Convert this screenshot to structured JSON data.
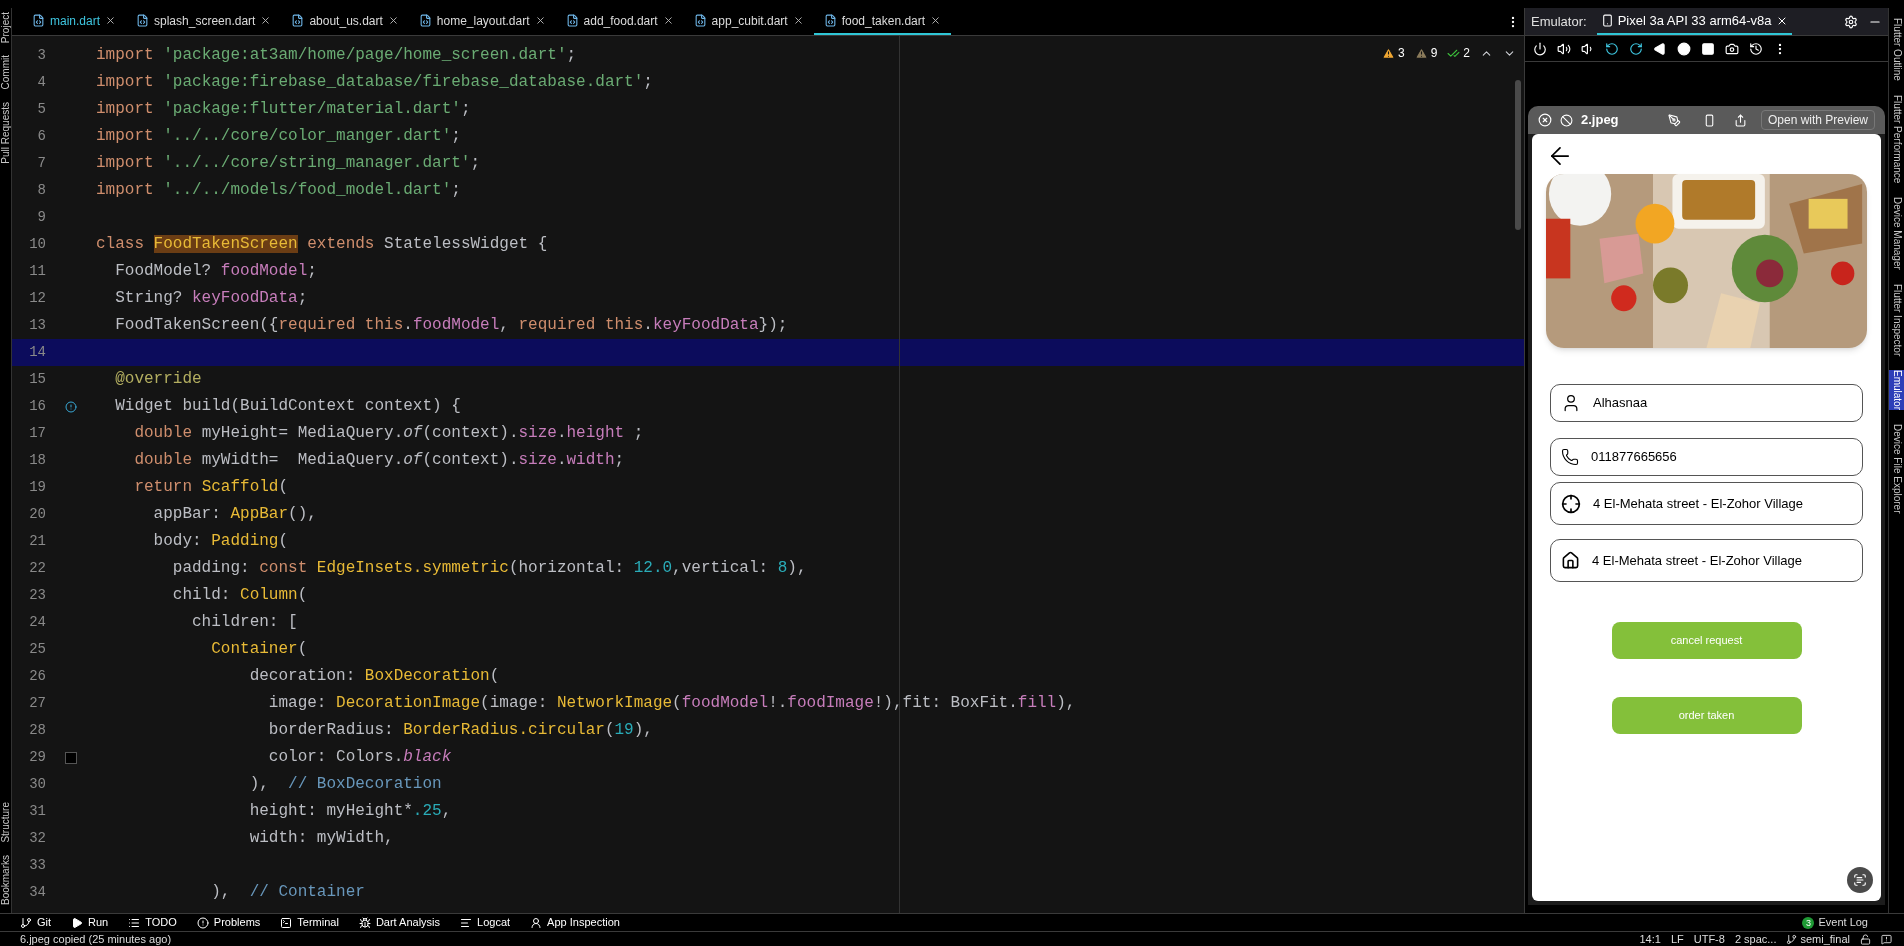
{
  "left_tool_windows_top": [
    {
      "label": "Project"
    },
    {
      "label": "Commit"
    },
    {
      "label": "Pull Requests"
    }
  ],
  "left_tool_windows_bottom": [
    {
      "label": "Structure"
    },
    {
      "label": "Bookmarks"
    }
  ],
  "editor_tabs": [
    {
      "label": "main.dart",
      "selected": false,
      "vcs_changed": true
    },
    {
      "label": "splash_screen.dart",
      "selected": false,
      "vcs_changed": false
    },
    {
      "label": "about_us.dart",
      "selected": false,
      "vcs_changed": false
    },
    {
      "label": "home_layout.dart",
      "selected": false,
      "vcs_changed": false
    },
    {
      "label": "add_food.dart",
      "selected": false,
      "vcs_changed": false
    },
    {
      "label": "app_cubit.dart",
      "selected": false,
      "vcs_changed": false
    },
    {
      "label": "food_taken.dart",
      "selected": true,
      "vcs_changed": false
    }
  ],
  "inspections": [
    {
      "kind": "warning",
      "count": "3"
    },
    {
      "kind": "weak_warning",
      "count": "9"
    },
    {
      "kind": "typo",
      "count": "2"
    }
  ],
  "code_lines": [
    {
      "number": "3",
      "current": false,
      "tokens": [
        {
          "kind": "kw",
          "text": "import "
        },
        {
          "kind": "str",
          "text": "'package:at3am/home/page/home_screen.dart'"
        },
        {
          "kind": "p",
          "text": ";"
        }
      ]
    },
    {
      "number": "4",
      "current": false,
      "tokens": [
        {
          "kind": "kw",
          "text": "import "
        },
        {
          "kind": "str",
          "text": "'package:firebase_database/firebase_database.dart'"
        },
        {
          "kind": "p",
          "text": ";"
        }
      ]
    },
    {
      "number": "5",
      "current": false,
      "tokens": [
        {
          "kind": "kw",
          "text": "import "
        },
        {
          "kind": "str",
          "text": "'package:flutter/material.dart'"
        },
        {
          "kind": "p",
          "text": ";"
        }
      ]
    },
    {
      "number": "6",
      "current": false,
      "tokens": [
        {
          "kind": "kw",
          "text": "import "
        },
        {
          "kind": "str",
          "text": "'../../core/color_manger.dart'"
        },
        {
          "kind": "p",
          "text": ";"
        }
      ]
    },
    {
      "number": "7",
      "current": false,
      "tokens": [
        {
          "kind": "kw",
          "text": "import "
        },
        {
          "kind": "str",
          "text": "'../../core/string_manager.dart'"
        },
        {
          "kind": "p",
          "text": ";"
        }
      ]
    },
    {
      "number": "8",
      "current": false,
      "tokens": [
        {
          "kind": "kw",
          "text": "import "
        },
        {
          "kind": "str",
          "text": "'../../models/food_model.dart'"
        },
        {
          "kind": "p",
          "text": ";"
        }
      ]
    },
    {
      "number": "9",
      "current": false
    },
    {
      "number": "10",
      "current": false,
      "tokens": [
        {
          "kind": "kw",
          "text": "class "
        },
        {
          "kind": "hl",
          "text": "FoodTakenScreen"
        },
        {
          "kind": "kw",
          "text": " extends "
        },
        {
          "kind": "p",
          "text": "StatelessWidget {"
        }
      ]
    },
    {
      "number": "11",
      "current": false,
      "tokens": [
        {
          "kind": "p",
          "text": "  FoodModel? "
        },
        {
          "kind": "field",
          "text": "foodModel"
        },
        {
          "kind": "p",
          "text": ";"
        }
      ]
    },
    {
      "number": "12",
      "current": false,
      "tokens": [
        {
          "kind": "p",
          "text": "  String? "
        },
        {
          "kind": "field",
          "text": "keyFoodData"
        },
        {
          "kind": "p",
          "text": ";"
        }
      ]
    },
    {
      "number": "13",
      "current": false,
      "tokens": [
        {
          "kind": "p",
          "text": "  FoodTakenScreen({"
        },
        {
          "kind": "kw",
          "text": "required this"
        },
        {
          "kind": "p",
          "text": "."
        },
        {
          "kind": "field",
          "text": "foodModel"
        },
        {
          "kind": "p",
          "text": ", "
        },
        {
          "kind": "kw",
          "text": "required this"
        },
        {
          "kind": "p",
          "text": "."
        },
        {
          "kind": "field",
          "text": "keyFoodData"
        },
        {
          "kind": "p",
          "text": "});"
        }
      ]
    },
    {
      "number": "14",
      "current": true
    },
    {
      "number": "15",
      "current": false,
      "tokens": [
        {
          "kind": "ann",
          "text": "  @override"
        }
      ]
    },
    {
      "number": "16",
      "current": false,
      "gutter": {
        "kind": "override"
      },
      "tokens": [
        {
          "kind": "p",
          "text": "  Widget build(BuildContext context) {"
        }
      ]
    },
    {
      "number": "17",
      "current": false,
      "tokens": [
        {
          "kind": "kw",
          "text": "    double "
        },
        {
          "kind": "p",
          "text": "myHeight= MediaQuery."
        },
        {
          "kind": "it",
          "text": "of"
        },
        {
          "kind": "p",
          "text": "(context)."
        },
        {
          "kind": "field",
          "text": "size"
        },
        {
          "kind": "p",
          "text": "."
        },
        {
          "kind": "field",
          "text": "height"
        },
        {
          "kind": "p",
          "text": " ;"
        }
      ]
    },
    {
      "number": "18",
      "current": false,
      "tokens": [
        {
          "kind": "kw",
          "text": "    double "
        },
        {
          "kind": "p",
          "text": "myWidth=  MediaQuery."
        },
        {
          "kind": "it",
          "text": "of"
        },
        {
          "kind": "p",
          "text": "(context)."
        },
        {
          "kind": "field",
          "text": "size"
        },
        {
          "kind": "p",
          "text": "."
        },
        {
          "kind": "field",
          "text": "width"
        },
        {
          "kind": "p",
          "text": ";"
        }
      ]
    },
    {
      "number": "19",
      "current": false,
      "tokens": [
        {
          "kind": "kw",
          "text": "    return "
        },
        {
          "kind": "fn",
          "text": "Scaffold"
        },
        {
          "kind": "p",
          "text": "("
        }
      ]
    },
    {
      "number": "20",
      "current": false,
      "tokens": [
        {
          "kind": "p",
          "text": "      appBar: "
        },
        {
          "kind": "fn",
          "text": "AppBar"
        },
        {
          "kind": "p",
          "text": "(),"
        }
      ]
    },
    {
      "number": "21",
      "current": false,
      "tokens": [
        {
          "kind": "p",
          "text": "      body: "
        },
        {
          "kind": "fn",
          "text": "Padding"
        },
        {
          "kind": "p",
          "text": "("
        }
      ]
    },
    {
      "number": "22",
      "current": false,
      "tokens": [
        {
          "kind": "p",
          "text": "        padding: "
        },
        {
          "kind": "kw",
          "text": "const "
        },
        {
          "kind": "fn",
          "text": "EdgeInsets.symmetric"
        },
        {
          "kind": "p",
          "text": "(horizontal: "
        },
        {
          "kind": "num",
          "text": "12.0"
        },
        {
          "kind": "p",
          "text": ",vertical: "
        },
        {
          "kind": "num",
          "text": "8"
        },
        {
          "kind": "p",
          "text": "),"
        }
      ]
    },
    {
      "number": "23",
      "current": false,
      "tokens": [
        {
          "kind": "p",
          "text": "        child: "
        },
        {
          "kind": "fn",
          "text": "Column"
        },
        {
          "kind": "p",
          "text": "("
        }
      ]
    },
    {
      "number": "24",
      "current": false,
      "tokens": [
        {
          "kind": "p",
          "text": "          children: ["
        }
      ]
    },
    {
      "number": "25",
      "current": false,
      "tokens": [
        {
          "kind": "fn",
          "text": "            Container"
        },
        {
          "kind": "p",
          "text": "("
        }
      ]
    },
    {
      "number": "26",
      "current": false,
      "tokens": [
        {
          "kind": "p",
          "text": "                decoration: "
        },
        {
          "kind": "fn",
          "text": "BoxDecoration"
        },
        {
          "kind": "p",
          "text": "("
        }
      ]
    },
    {
      "number": "27",
      "current": false,
      "tokens": [
        {
          "kind": "p",
          "text": "                  image: "
        },
        {
          "kind": "fn",
          "text": "DecorationImage"
        },
        {
          "kind": "p",
          "text": "(image: "
        },
        {
          "kind": "fn",
          "text": "NetworkImage"
        },
        {
          "kind": "p",
          "text": "("
        },
        {
          "kind": "field",
          "text": "foodModel"
        },
        {
          "kind": "p",
          "text": "!."
        },
        {
          "kind": "field",
          "text": "foodImage"
        },
        {
          "kind": "p",
          "text": "!),fit: BoxFit."
        },
        {
          "kind": "field",
          "text": "fill"
        },
        {
          "kind": "p",
          "text": "),"
        }
      ]
    },
    {
      "number": "28",
      "current": false,
      "tokens": [
        {
          "kind": "p",
          "text": "                  borderRadius: "
        },
        {
          "kind": "fn",
          "text": "BorderRadius.circular"
        },
        {
          "kind": "p",
          "text": "("
        },
        {
          "kind": "num",
          "text": "19"
        },
        {
          "kind": "p",
          "text": "),"
        }
      ]
    },
    {
      "number": "29",
      "current": false,
      "gutter": {
        "kind": "swatch"
      },
      "tokens": [
        {
          "kind": "p",
          "text": "                  color: Colors."
        },
        {
          "kind": "fieldit",
          "text": "black"
        }
      ]
    },
    {
      "number": "30",
      "current": false,
      "tokens": [
        {
          "kind": "p",
          "text": "                ),  "
        },
        {
          "kind": "cm",
          "text": "// BoxDecoration"
        }
      ]
    },
    {
      "number": "31",
      "current": false,
      "tokens": [
        {
          "kind": "p",
          "text": "                height: myHeight*"
        },
        {
          "kind": "num",
          "text": ".25"
        },
        {
          "kind": "p",
          "text": ","
        }
      ]
    },
    {
      "number": "32",
      "current": false,
      "tokens": [
        {
          "kind": "p",
          "text": "                width: myWidth,"
        }
      ]
    },
    {
      "number": "33",
      "current": false
    },
    {
      "number": "34",
      "current": false,
      "tokens": [
        {
          "kind": "p",
          "text": "            ),  "
        },
        {
          "kind": "cm",
          "text": "// Container"
        }
      ]
    }
  ],
  "emulator": {
    "label": "Emulator:",
    "device_tab": "Pixel 3a API 33 arm64-v8a"
  },
  "preview": {
    "file_name": "2.jpeg",
    "open_button": "Open with Preview",
    "fields": [
      {
        "kind": "person",
        "value": "Alhasnaa"
      },
      {
        "kind": "phone",
        "value": "011877665656"
      },
      {
        "kind": "location",
        "value": "4 El-Mehata street - El-Zohor Village"
      },
      {
        "kind": "home",
        "value": "4 El-Mehata street - El-Zohor Village"
      }
    ],
    "buttons": [
      "cancel request",
      "order taken"
    ]
  },
  "right_tool_windows": [
    {
      "label": "Flutter Outline",
      "selected": false
    },
    {
      "label": "Flutter Performance",
      "selected": false
    },
    {
      "label": "Device Manager",
      "selected": false
    },
    {
      "label": "Flutter Inspector",
      "selected": false
    },
    {
      "label": "Emulator",
      "selected": true
    },
    {
      "label": "Device File Explorer",
      "selected": false
    }
  ],
  "bottom_tools": [
    {
      "kind": "git",
      "label": "Git"
    },
    {
      "kind": "run",
      "label": "Run"
    },
    {
      "kind": "todo",
      "label": "TODO"
    },
    {
      "kind": "problems",
      "label": "Problems"
    },
    {
      "kind": "terminal",
      "label": "Terminal"
    },
    {
      "kind": "dart_analysis",
      "label": "Dart Analysis"
    },
    {
      "kind": "logcat",
      "label": "Logcat"
    },
    {
      "kind": "app_inspection",
      "label": "App Inspection"
    }
  ],
  "event_log": {
    "label": "Event Log",
    "count": "3"
  },
  "status_bar": {
    "message": "6.jpeg copied (25 minutes ago)",
    "position": "14:1",
    "line_separator": "LF",
    "encoding": "UTF-8",
    "indent": "2 spac...",
    "branch": "semi_final"
  }
}
